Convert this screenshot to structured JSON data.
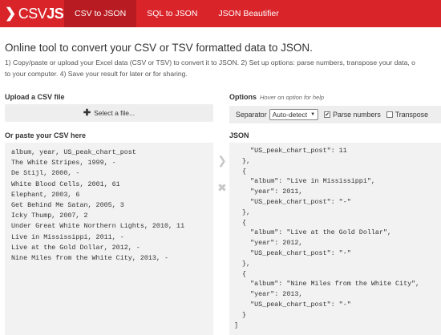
{
  "navbar": {
    "brand_csv": "CSV",
    "brand_json": "JSON",
    "brand_icon": "chevron-right-icon",
    "items": [
      {
        "label": "CSV to JSON",
        "active": true
      },
      {
        "label": "SQL to JSON",
        "active": false
      },
      {
        "label": "JSON Beautifier",
        "active": false
      }
    ]
  },
  "intro": {
    "headline": "Online tool to convert your CSV or TSV formatted data to JSON.",
    "line1": "1) Copy/paste or upload your Excel data (CSV or TSV) to convert it to JSON. 2) Set up options: parse numbers, transpose your data, o",
    "line2": "to your computer. 4) Save your result for later or for sharing."
  },
  "upload": {
    "heading": "Upload a CSV file",
    "button_label": "Select a file..."
  },
  "options": {
    "heading": "Options",
    "hint": "Hover on option for help",
    "separator_label": "Separator",
    "separator_value": "Auto-detect",
    "parse_numbers_label": "Parse numbers",
    "parse_numbers_checked": true,
    "transpose_label": "Transpose",
    "transpose_checked": false
  },
  "csv_input": {
    "heading": "Or paste your CSV here",
    "lines": [
      "album, year, US_peak_chart_post",
      "The White Stripes, 1999, -",
      "De Stijl, 2000, -",
      "White Blood Cells, 2001, 61",
      "Elephant, 2003, 6",
      "Get Behind Me Satan, 2005, 3",
      "Icky Thump, 2007, 2",
      "Under Great White Northern Lights, 2010, 11",
      "Live in Mississippi, 2011, -",
      "Live at the Gold Dollar, 2012, -",
      "Nine Miles from the White City, 2013, -"
    ]
  },
  "json_output": {
    "heading": "JSON",
    "lines": [
      "    \"US_peak_chart_post\": 11",
      "  },",
      "  {",
      "    \"album\": \"Live in Mississippi\",",
      "    \"year\": 2011,",
      "    \"US_peak_chart_post\": \"-\"",
      "  },",
      "  {",
      "    \"album\": \"Live at the Gold Dollar\",",
      "    \"year\": 2012,",
      "    \"US_peak_chart_post\": \"-\"",
      "  },",
      "  {",
      "    \"album\": \"Nine Miles from the White City\",",
      "    \"year\": 2013,",
      "    \"US_peak_chart_post\": \"-\"",
      "  }",
      "]"
    ]
  },
  "controls": {
    "convert_icon": "chevron-right-icon",
    "clear_icon": "close-icon"
  }
}
